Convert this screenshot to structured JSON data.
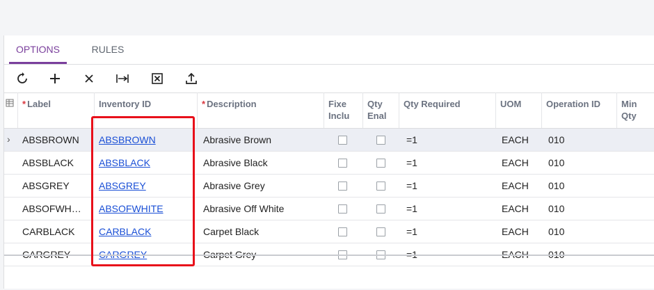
{
  "tabs": [
    {
      "label": "OPTIONS",
      "active": true
    },
    {
      "label": "RULES",
      "active": false
    }
  ],
  "toolbar": {
    "refresh_icon": "refresh-icon",
    "add_icon": "plus-icon",
    "delete_icon": "close-icon",
    "fit_icon": "fit-to-screen-icon",
    "excel_icon": "export-excel-icon",
    "upload_icon": "upload-icon"
  },
  "columns": {
    "settings_icon": "column-settings-icon",
    "label": "Label",
    "inventory_id": "Inventory ID",
    "description": "Description",
    "fixed_incl": "Fixe\nInclu",
    "qty_enabled": "Qty\nEnal",
    "qty_required": "Qty Required",
    "uom": "UOM",
    "operation_id": "Operation ID",
    "min_qty": "Min\nQty"
  },
  "rows": [
    {
      "label": "ABSBROWN",
      "inventory_id": "ABSBROWN",
      "description": "Abrasive Brown",
      "qty_required": "=1",
      "uom": "EACH",
      "operation_id": "010"
    },
    {
      "label": "ABSBLACK",
      "inventory_id": "ABSBLACK",
      "description": "Abrasive Black",
      "qty_required": "=1",
      "uom": "EACH",
      "operation_id": "010"
    },
    {
      "label": "ABSGREY",
      "inventory_id": "ABSGREY",
      "description": "Abrasive Grey",
      "qty_required": "=1",
      "uom": "EACH",
      "operation_id": "010"
    },
    {
      "label": "ABSOFWH…",
      "inventory_id": "ABSOFWHITE",
      "description": "Abrasive Off White",
      "qty_required": "=1",
      "uom": "EACH",
      "operation_id": "010"
    },
    {
      "label": "CARBLACK",
      "inventory_id": "CARBLACK",
      "description": "Carpet Black",
      "qty_required": "=1",
      "uom": "EACH",
      "operation_id": "010"
    },
    {
      "label": "CARGREY",
      "inventory_id": "CARGREY",
      "description": "Carpet Grey",
      "qty_required": "=1",
      "uom": "EACH",
      "operation_id": "010"
    }
  ],
  "colors": {
    "accent": "#7a3f9c",
    "link": "#1a4fd6",
    "highlight": "#e8101a"
  }
}
